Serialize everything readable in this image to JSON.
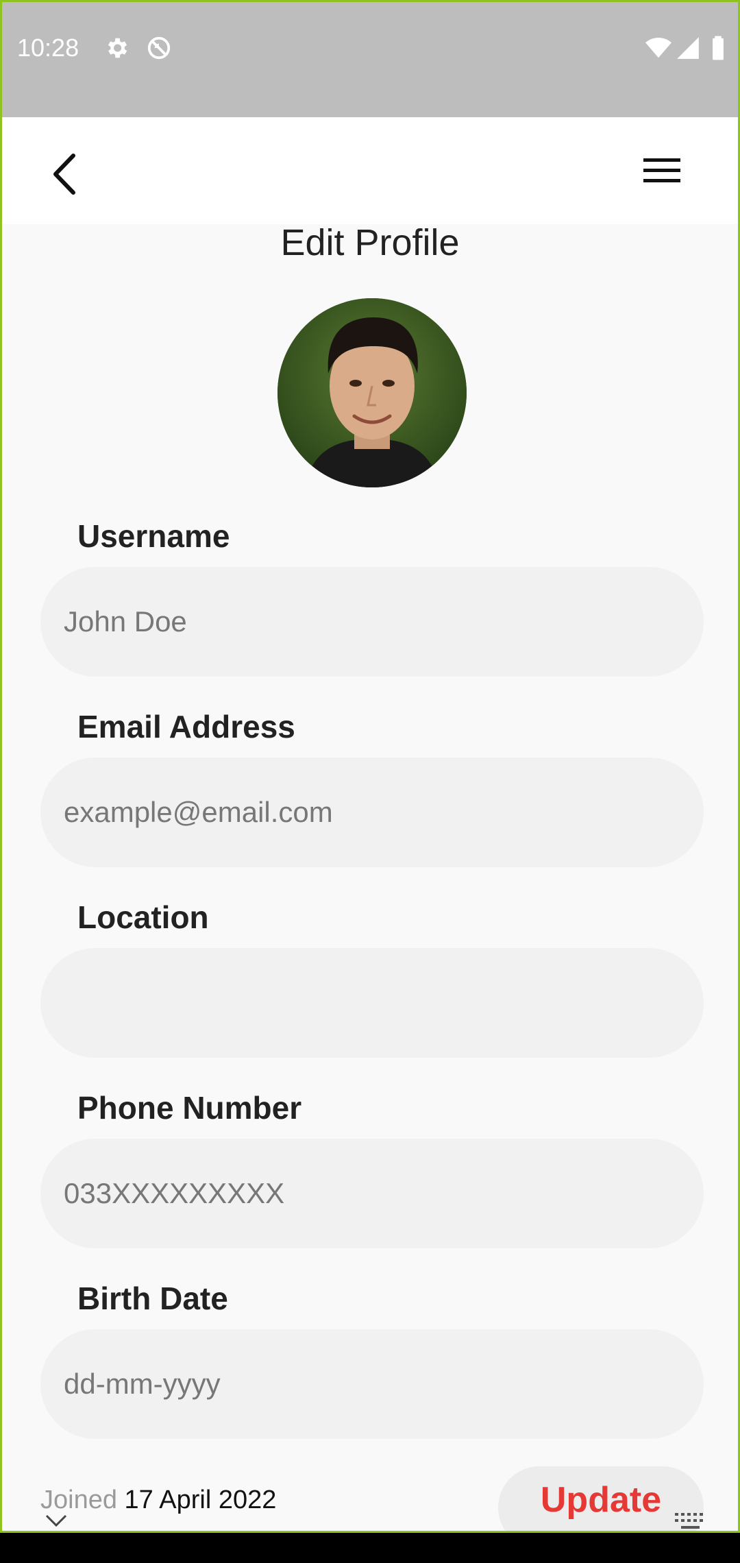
{
  "status_bar": {
    "time": "10:28",
    "icons": [
      "gear-icon",
      "do-not-disturb-icon",
      "wifi-icon",
      "signal-icon",
      "battery-icon"
    ]
  },
  "app_bar": {
    "back_icon": "back-arrow-icon",
    "menu_icon": "hamburger-menu-icon"
  },
  "page": {
    "title": "Edit Profile"
  },
  "form": {
    "username": {
      "label": "Username",
      "value": "",
      "placeholder": "John Doe"
    },
    "email": {
      "label": "Email Address",
      "value": "",
      "placeholder": "example@email.com"
    },
    "location": {
      "label": "Location",
      "value": "",
      "placeholder": ""
    },
    "phone": {
      "label": "Phone Number",
      "value": "",
      "placeholder": "033XXXXXXXXX"
    },
    "birth_date": {
      "label": "Birth Date",
      "value": "",
      "placeholder": "dd-mm-yyyy"
    }
  },
  "footer": {
    "joined_label": "Joined",
    "joined_date": "17 April 2022",
    "update_label": "Update"
  },
  "colors": {
    "accent": "#e53935",
    "status_bar": "#bdbdbd",
    "field_bg": "#f1f1f1",
    "frame_border": "#8fc31f"
  }
}
